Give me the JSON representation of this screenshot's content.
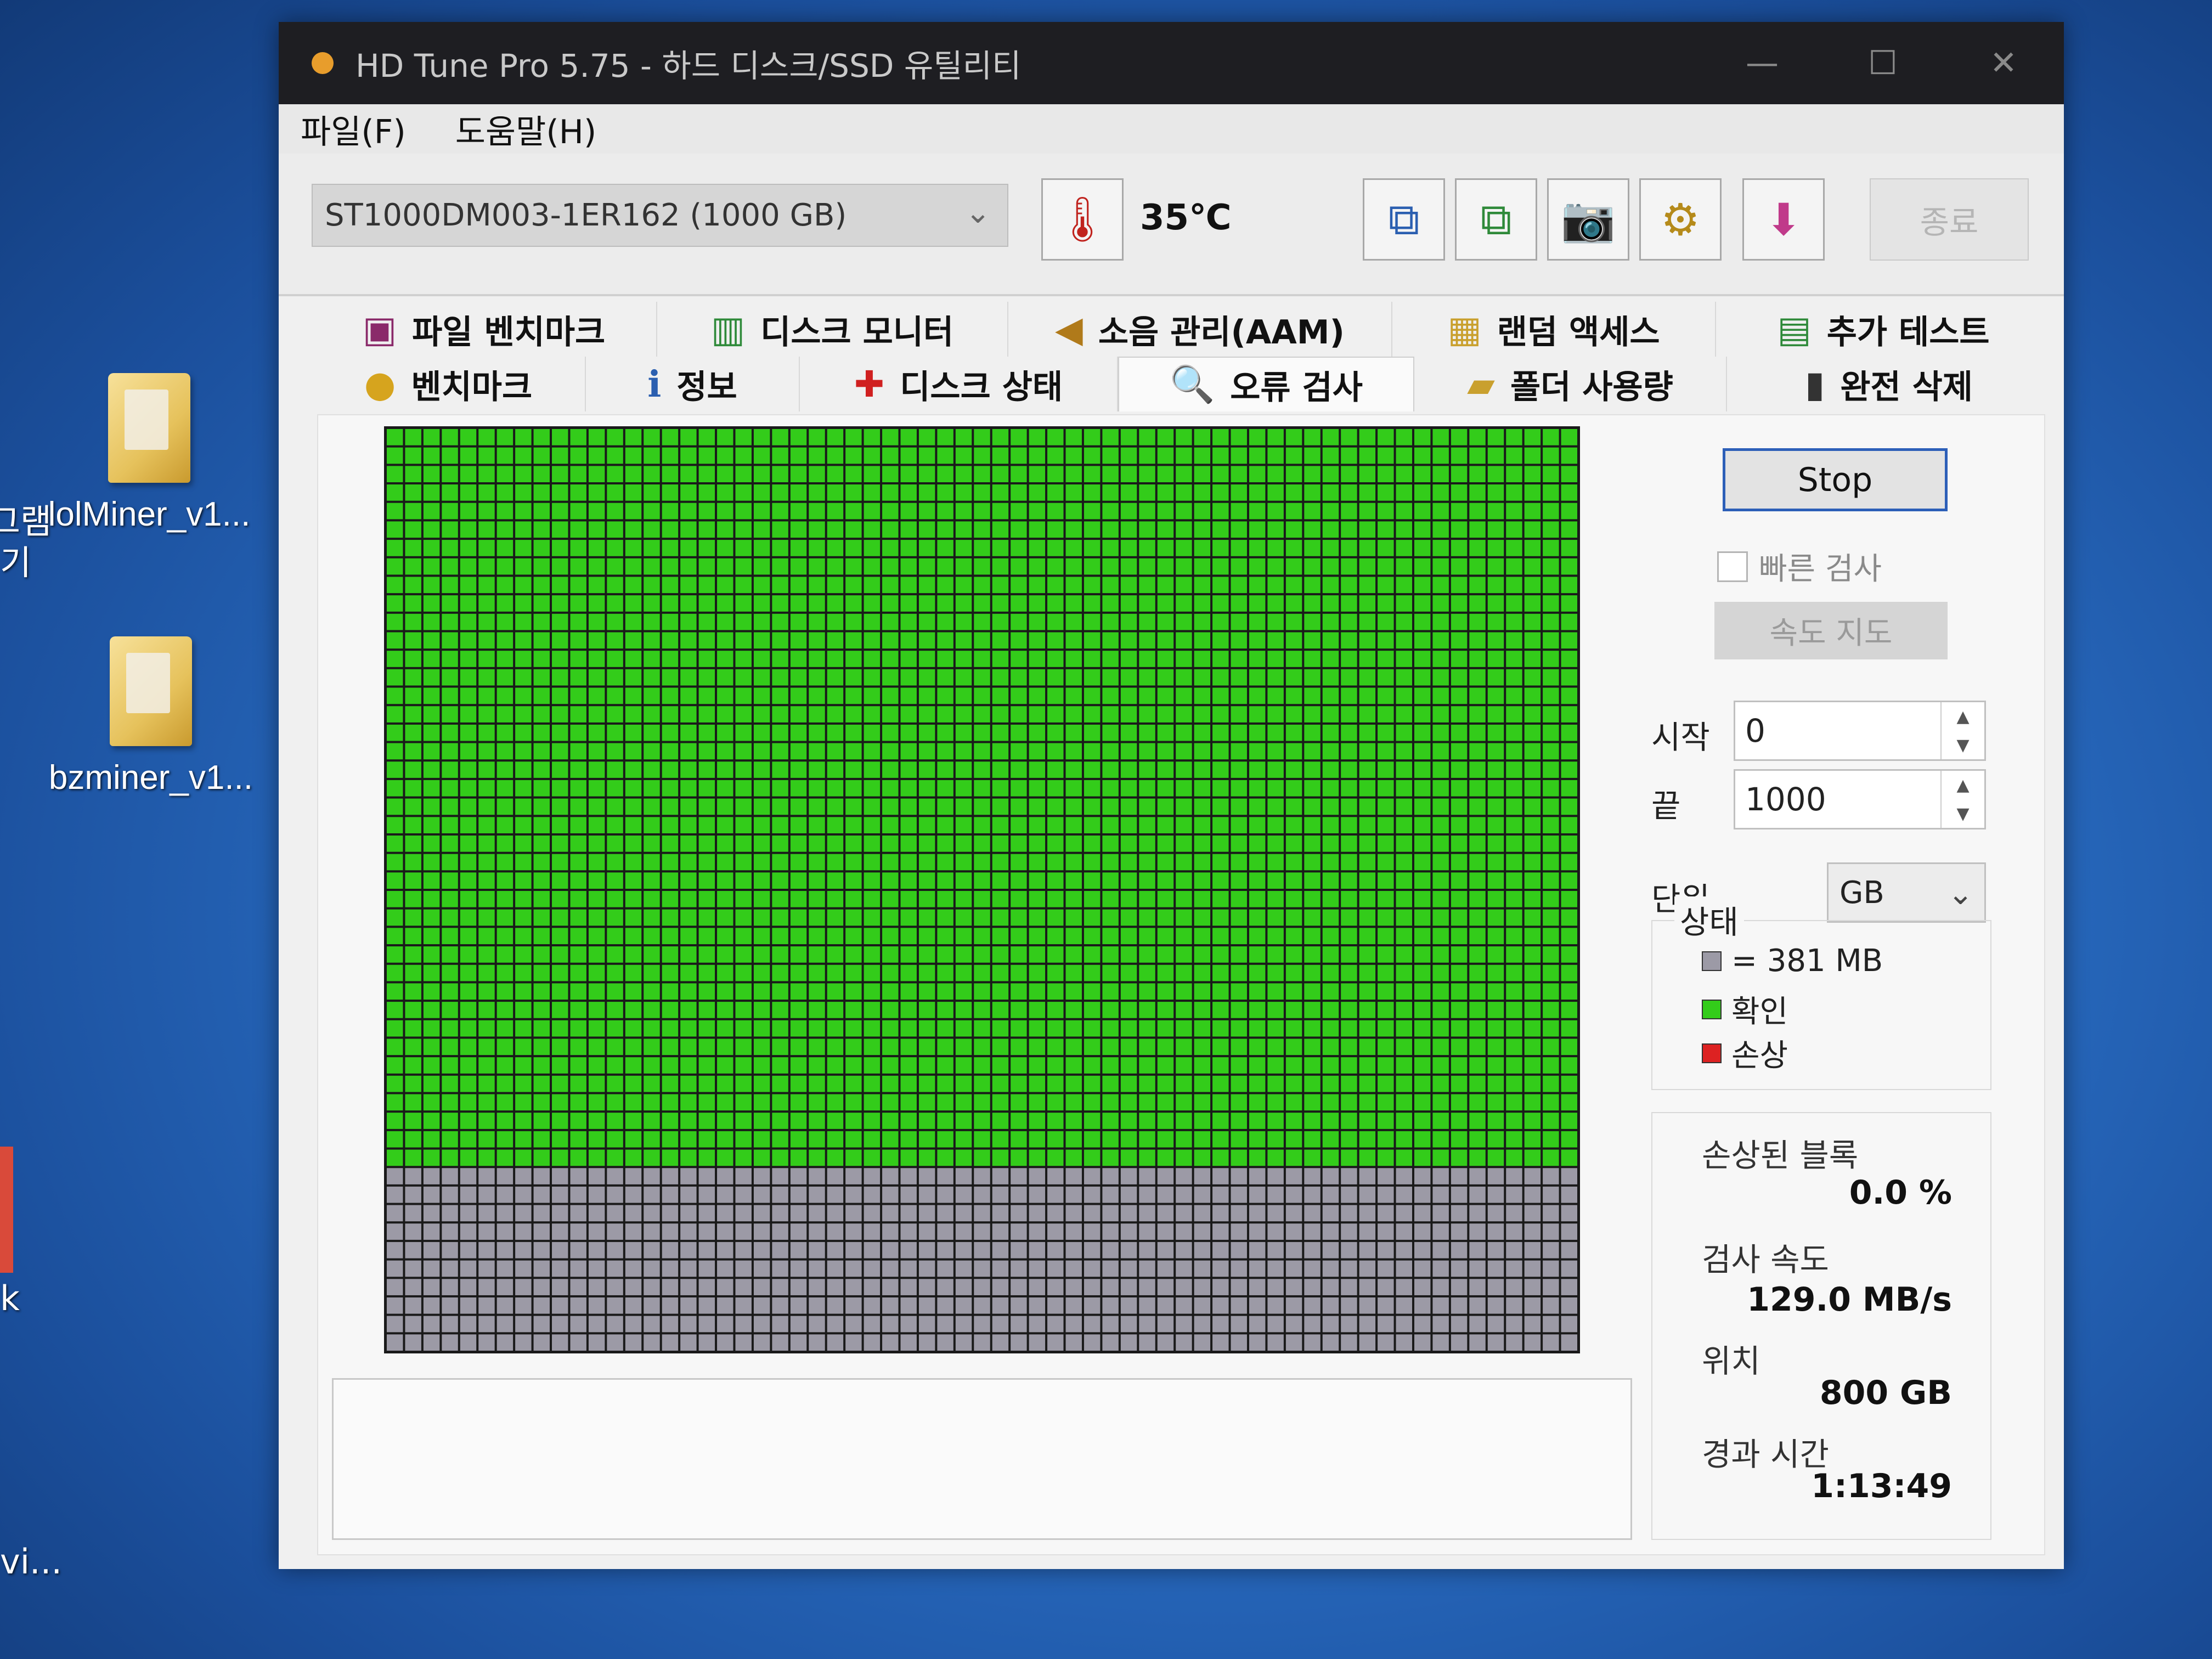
{
  "window": {
    "title": "HD Tune Pro 5.75 - 하드 디스크/SSD 유틸리티",
    "minimize": "—",
    "maximize": "☐",
    "close": "✕"
  },
  "menu": {
    "file": "파일(F)",
    "help": "도움말(H)"
  },
  "toolbar": {
    "drive": "ST1000DM003-1ER162 (1000 GB)",
    "temperature": "35℃",
    "exit_label": "종료"
  },
  "tabs_top": [
    {
      "label": "파일 벤치마크",
      "icon": "file-benchmark-icon"
    },
    {
      "label": "디스크 모니터",
      "icon": "disk-monitor-icon"
    },
    {
      "label": "소음 관리(AAM)",
      "icon": "speaker-icon"
    },
    {
      "label": "랜덤 액세스",
      "icon": "random-access-icon"
    },
    {
      "label": "추가 테스트",
      "icon": "extra-tests-icon"
    }
  ],
  "tabs_bottom": [
    {
      "label": "벤치마크",
      "icon": "benchmark-icon"
    },
    {
      "label": "정보",
      "icon": "info-icon"
    },
    {
      "label": "디스크 상태",
      "icon": "health-icon"
    },
    {
      "label": "오류 검사",
      "icon": "magnifier-icon",
      "active": true
    },
    {
      "label": "폴더 사용량",
      "icon": "folder-icon"
    },
    {
      "label": "완전 삭제",
      "icon": "trash-icon"
    }
  ],
  "scan_map": {
    "columns": 65,
    "rows": 50,
    "checked_fraction": 0.8,
    "colors": {
      "checked": "#33cc1a",
      "unscanned": "#9c9aa6",
      "damaged": "#dd2222",
      "grid": "#1a1a1a"
    }
  },
  "controls": {
    "stop_label": "Stop",
    "quick_scan_label": "빠른 검사",
    "speed_map_label": "속도 지도",
    "start_label": "시작",
    "start_value": "0",
    "end_label": "끝",
    "end_value": "1000",
    "unit_label": "단위",
    "unit_value": "GB"
  },
  "legend": {
    "title": "상태",
    "block_size": "= 381 MB",
    "ok": "확인",
    "damaged": "손상"
  },
  "stats": {
    "damaged_blocks_label": "손상된 블록",
    "damaged_blocks_value": "0.0 %",
    "speed_label": "검사 속도",
    "speed_value": "129.0 MB/s",
    "position_label": "위치",
    "position_value": "800 GB",
    "elapsed_label": "경과 시간",
    "elapsed_value": "1:13:49"
  },
  "desktop": {
    "icon1_label": "lolMiner_v1...",
    "icon2_label": "bzminer_v1...",
    "edge_text_1": "그램",
    "edge_text_2": "기",
    "edge_text_3": "k",
    "edge_text_4": "vi..."
  }
}
